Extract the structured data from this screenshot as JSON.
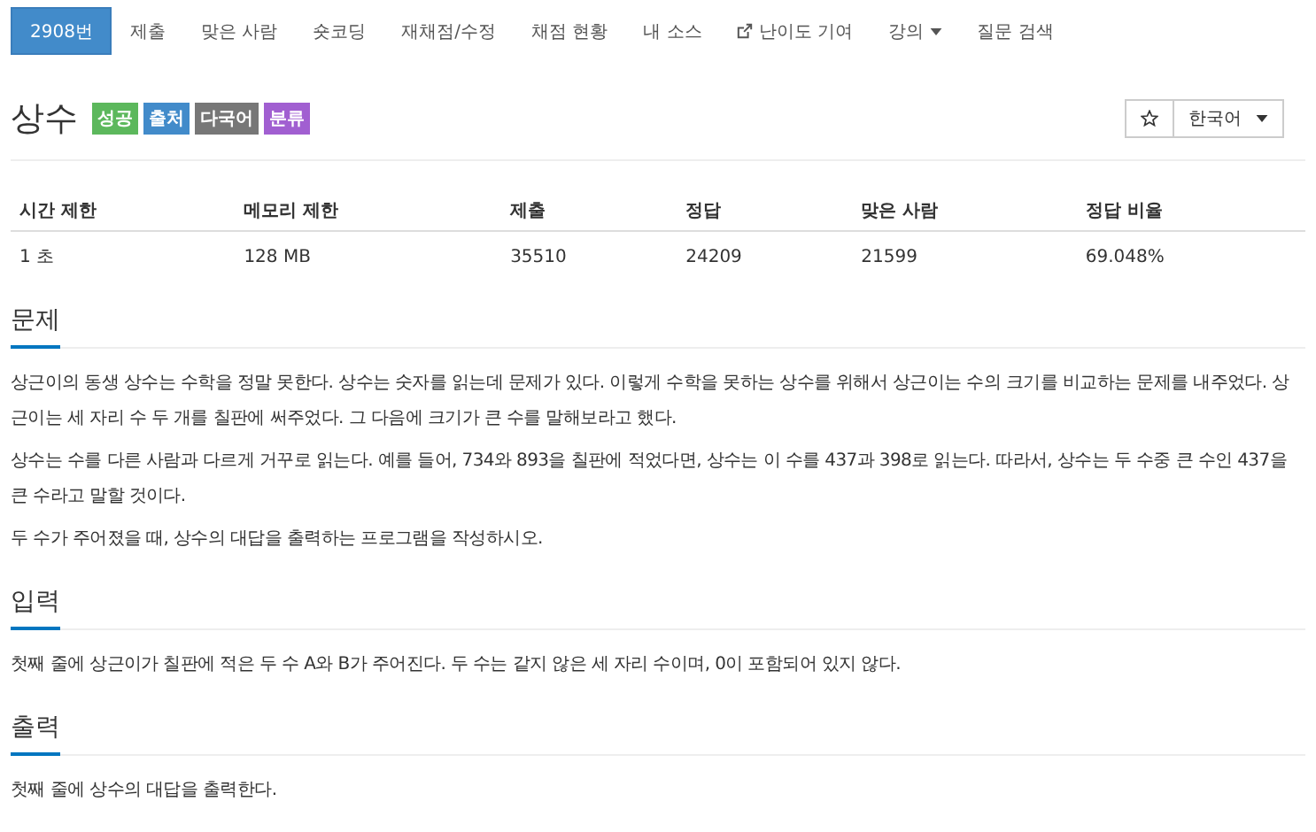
{
  "nav": [
    {
      "label": "2908번",
      "selected": true,
      "kind": "plain"
    },
    {
      "label": "제출",
      "selected": false,
      "kind": "plain"
    },
    {
      "label": "맞은 사람",
      "selected": false,
      "kind": "plain"
    },
    {
      "label": "숏코딩",
      "selected": false,
      "kind": "plain"
    },
    {
      "label": "재채점/수정",
      "selected": false,
      "kind": "plain"
    },
    {
      "label": "채점 현황",
      "selected": false,
      "kind": "plain"
    },
    {
      "label": "내 소스",
      "selected": false,
      "kind": "plain"
    },
    {
      "label": "난이도 기여",
      "selected": false,
      "kind": "external"
    },
    {
      "label": "강의",
      "selected": false,
      "kind": "dropdown"
    },
    {
      "label": "질문 검색",
      "selected": false,
      "kind": "plain"
    }
  ],
  "title": "상수",
  "badges": [
    {
      "label": "성공",
      "color": "#5cb85c"
    },
    {
      "label": "출처",
      "color": "#428bca"
    },
    {
      "label": "다국어",
      "color": "#777777"
    },
    {
      "label": "분류",
      "color": "#a15fd1"
    }
  ],
  "language": "한국어",
  "table": {
    "columns": [
      "시간 제한",
      "메모리 제한",
      "제출",
      "정답",
      "맞은 사람",
      "정답 비율"
    ],
    "rows": [
      [
        "1 초",
        "128 MB",
        "35510",
        "24209",
        "21599",
        "69.048%"
      ]
    ]
  },
  "sections": [
    {
      "title": "문제",
      "paragraphs": [
        "상근이의 동생 상수는 수학을 정말 못한다. 상수는 숫자를 읽는데 문제가 있다. 이렇게 수학을 못하는 상수를 위해서 상근이는 수의 크기를 비교하는 문제를 내주었다. 상근이는 세 자리 수 두 개를 칠판에 써주었다. 그 다음에 크기가 큰 수를 말해보라고 했다.",
        "상수는 수를 다른 사람과 다르게 거꾸로 읽는다. 예를 들어, 734와 893을 칠판에 적었다면, 상수는 이 수를 437과 398로 읽는다. 따라서, 상수는 두 수중 큰 수인 437을 큰 수라고 말할 것이다.",
        "두 수가 주어졌을 때, 상수의 대답을 출력하는 프로그램을 작성하시오."
      ]
    },
    {
      "title": "입력",
      "paragraphs": [
        "첫째 줄에 상근이가 칠판에 적은 두 수 A와 B가 주어진다. 두 수는 같지 않은 세 자리 수이며, 0이 포함되어 있지 않다."
      ]
    },
    {
      "title": "출력",
      "paragraphs": [
        "첫째 줄에 상수의 대답을 출력한다."
      ]
    }
  ]
}
